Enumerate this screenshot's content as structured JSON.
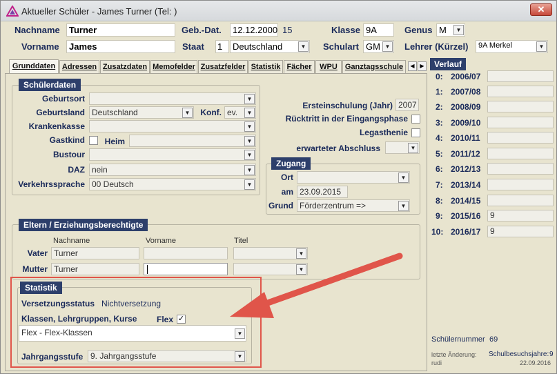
{
  "window": {
    "title": "Aktueller Schüler - James Turner (Tel: )",
    "close": "✕",
    "accent": "#2d3f6b"
  },
  "header": {
    "nachname_label": "Nachname",
    "nachname": "Turner",
    "vorname_label": "Vorname",
    "vorname": "James",
    "gebdat_label": "Geb.-Dat.",
    "gebdat": "12.12.2000",
    "alter": "15",
    "staat_label": "Staat",
    "staat_num": "1",
    "staat": "Deutschland",
    "klasse_label": "Klasse",
    "klasse": "9A",
    "schulart_label": "Schulart",
    "schulart": "GM",
    "genus_label": "Genus",
    "genus": "M",
    "lehrer_label": "Lehrer (Kürzel)",
    "lehrer": "9A Merkel"
  },
  "tabs": [
    "Grunddaten",
    "Adressen",
    "Zusatzdaten",
    "Memofelder",
    "Zusatzfelder",
    "Statistik",
    "Fächer",
    "WPU",
    "Ganztagsschule"
  ],
  "schuelerdaten": {
    "title": "Schülerdaten",
    "geburtsort_label": "Geburtsort",
    "geburtsort": "",
    "geburtsland_label": "Geburtsland",
    "geburtsland": "Deutschland",
    "konf_label": "Konf.",
    "konf": "ev.",
    "krankenkasse_label": "Krankenkasse",
    "krankenkasse": "",
    "gastkind_label": "Gastkind",
    "heim_label": "Heim",
    "heim": "",
    "bustour_label": "Bustour",
    "bustour": "",
    "daz_label": "DAZ",
    "daz": "nein",
    "verkehrssprache_label": "Verkehrssprache",
    "verkehrssprache": "00 Deutsch",
    "einschulung_label": "Ersteinschulung (Jahr)",
    "einschulung": "2007",
    "ruecktritt_label": "Rücktritt in der Eingangsphase",
    "legasthenie_label": "Legasthenie",
    "abschluss_label": "erwarteter Abschluss",
    "abschluss": ""
  },
  "zugang": {
    "title": "Zugang",
    "ort_label": "Ort",
    "ort": "",
    "am_label": "am",
    "am": "23.09.2015",
    "grund_label": "Grund",
    "grund": "Förderzentrum =>"
  },
  "eltern": {
    "title": "Eltern / Erziehungsberechtigte",
    "col_nachname": "Nachname",
    "col_vorname": "Vorname",
    "col_titel": "Titel",
    "vater_label": "Vater",
    "vater_nachname": "Turner",
    "vater_vorname": "",
    "vater_titel": "",
    "mutter_label": "Mutter",
    "mutter_nachname": "Turner",
    "mutter_vorname": "",
    "mutter_titel": ""
  },
  "statistik": {
    "title": "Statistik",
    "versetzung_label": "Versetzungsstatus",
    "versetzung": "Nichtversetzung",
    "klassen_label": "Klassen, Lehrgruppen, Kurse",
    "flex_label": "Flex",
    "flex_checked": "✓",
    "klassen": "Flex - Flex-Klassen",
    "jahrgang_label": "Jahrgangsstufe",
    "jahrgang": "9. Jahrgangsstufe"
  },
  "verlauf": {
    "title": "Verlauf",
    "rows": [
      {
        "idx": "0:",
        "year": "2006/07",
        "val": ""
      },
      {
        "idx": "1:",
        "year": "2007/08",
        "val": ""
      },
      {
        "idx": "2:",
        "year": "2008/09",
        "val": ""
      },
      {
        "idx": "3:",
        "year": "2009/10",
        "val": ""
      },
      {
        "idx": "4:",
        "year": "2010/11",
        "val": ""
      },
      {
        "idx": "5:",
        "year": "2011/12",
        "val": ""
      },
      {
        "idx": "6:",
        "year": "2012/13",
        "val": ""
      },
      {
        "idx": "7:",
        "year": "2013/14",
        "val": ""
      },
      {
        "idx": "8:",
        "year": "2014/15",
        "val": ""
      },
      {
        "idx": "9:",
        "year": "2015/16",
        "val": "9"
      },
      {
        "idx": "10:",
        "year": "2016/17",
        "val": "9"
      }
    ],
    "schuelernummer_label": "Schülernummer",
    "schuelernummer": "69",
    "letzte_label": "letzte Änderung:",
    "letzte_user": "rudi",
    "besuchsjahre_label": "Schulbesuchsjahre:",
    "besuchsjahre": "9",
    "letzte_datum": "22.09.2016"
  }
}
